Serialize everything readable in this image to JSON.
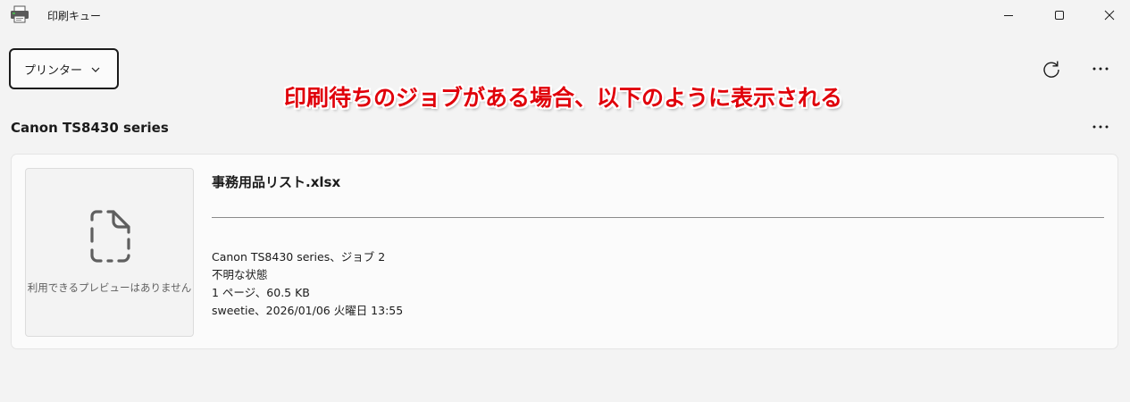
{
  "window": {
    "title": "印刷キュー",
    "icon": "printer-icon"
  },
  "toolbar": {
    "printer_dropdown_label": "プリンター",
    "refresh_icon": "refresh-icon",
    "more_icon": "more-horizontal-icon"
  },
  "annotation": {
    "text": "印刷待ちのジョブがある場合、以下のように表示される",
    "color": "#e0000a"
  },
  "printer": {
    "name": "Canon TS8430 series",
    "jobs": [
      {
        "name": "事務用品リスト.xlsx",
        "preview_label": "利用できるプレビューはありません",
        "details": [
          "Canon TS8430 series、ジョブ 2",
          "不明な状態",
          "1 ページ、60.5 KB",
          "sweetie、2026/01/06 火曜日 13:55"
        ]
      }
    ]
  }
}
